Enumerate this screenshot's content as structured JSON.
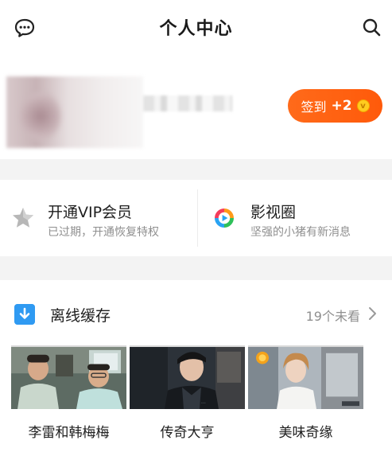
{
  "header": {
    "title": "个人中心",
    "chat_icon": "chat-bubble-icon",
    "search_icon": "search-icon"
  },
  "profile": {
    "checkin_label": "签到",
    "checkin_points": "+2",
    "coin_symbol": "v",
    "accent": "#ff5f12"
  },
  "features": {
    "vip": {
      "title": "开通VIP会员",
      "subtitle": "已过期，开通恢复特权",
      "icon": "star-icon"
    },
    "circle": {
      "title": "影视圈",
      "subtitle": "坚强的小猪有新消息",
      "icon": "play-circle-icon"
    }
  },
  "offline": {
    "title": "离线缓存",
    "count_text": "19个未看",
    "icon": "download-icon"
  },
  "videos": [
    {
      "title": "李雷和韩梅梅"
    },
    {
      "title": "传奇大亨"
    },
    {
      "title": "美味奇缘"
    }
  ]
}
